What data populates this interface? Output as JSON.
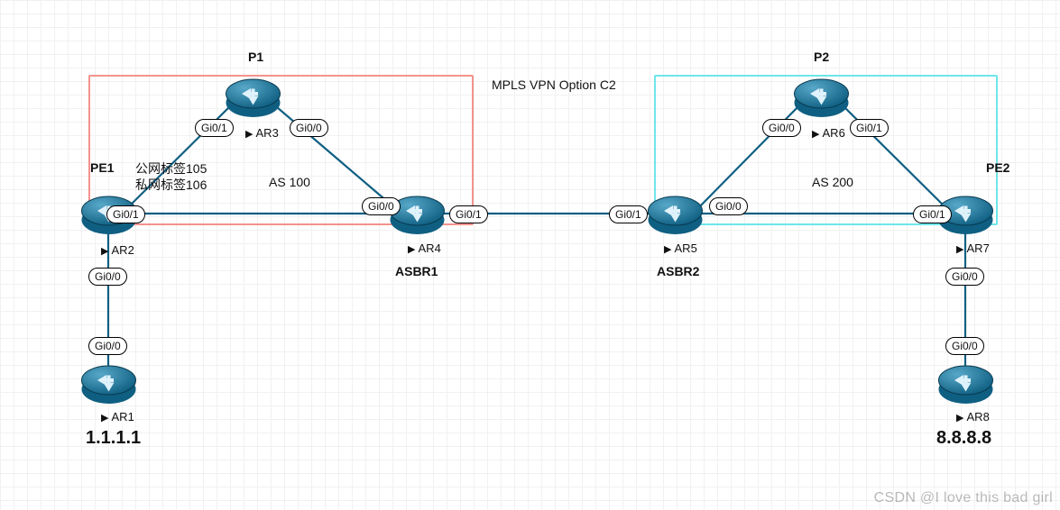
{
  "title": "MPLS VPN Option C2",
  "watermark": "CSDN @I love this bad girl",
  "as": {
    "left": {
      "label": "AS 100",
      "color": "#f3938c"
    },
    "right": {
      "label": "AS 200",
      "color": "#6ee6ea"
    }
  },
  "roles": {
    "pe1": "PE1",
    "pe2": "PE2",
    "p1": "P1",
    "p2": "P2",
    "asbr1": "ASBR1",
    "asbr2": "ASBR2"
  },
  "notes": {
    "public_label": "公网标签105",
    "private_label": "私网标签106"
  },
  "routers": {
    "ar1": {
      "label": "AR1",
      "ip": "1.1.1.1"
    },
    "ar2": {
      "label": "AR2"
    },
    "ar3": {
      "label": "AR3"
    },
    "ar4": {
      "label": "AR4"
    },
    "ar5": {
      "label": "AR5"
    },
    "ar6": {
      "label": "AR6"
    },
    "ar7": {
      "label": "AR7"
    },
    "ar8": {
      "label": "AR8",
      "ip": "8.8.8.8"
    }
  },
  "ports": {
    "ar2_g00": "Gi0/0",
    "ar2_g01": "Gi0/1",
    "ar1_g00": "Gi0/0",
    "ar3_g00": "Gi0/0",
    "ar3_g01": "Gi0/1",
    "ar4_g00": "Gi0/0",
    "ar4_g01": "Gi0/1",
    "ar5_g00": "Gi0/0",
    "ar5_g01": "Gi0/1",
    "ar6_g00": "Gi0/0",
    "ar6_g01": "Gi0/1",
    "ar7_g00": "Gi0/0",
    "ar7_g01": "Gi0/1",
    "ar8_g00": "Gi0/0"
  }
}
